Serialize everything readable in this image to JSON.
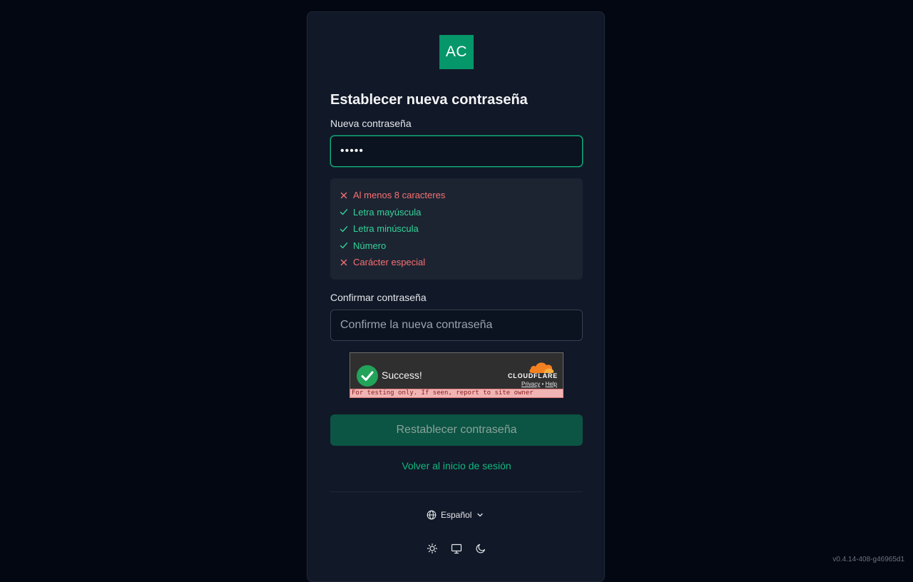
{
  "logo": {
    "text": "AC",
    "color": "#059669"
  },
  "form": {
    "title": "Establecer nueva contraseña",
    "new_password_label": "Nueva contraseña",
    "new_password_value": "•••••",
    "rules": [
      {
        "text": "Al menos 8 caracteres",
        "status": "fail"
      },
      {
        "text": "Letra mayúscula",
        "status": "ok"
      },
      {
        "text": "Letra minúscula",
        "status": "ok"
      },
      {
        "text": "Número",
        "status": "ok"
      },
      {
        "text": "Carácter especial",
        "status": "fail"
      }
    ],
    "confirm_label": "Confirmar contraseña",
    "confirm_placeholder": "Confirme la nueva contraseña",
    "submit_label": "Restablecer contraseña",
    "back_link": "Volver al inicio de sesión"
  },
  "captcha": {
    "status": "Success!",
    "brand": "CLOUDFLARE",
    "privacy": "Privacy",
    "separator": "•",
    "help": "Help",
    "banner": "For testing only. If seen, report to site owner"
  },
  "footer": {
    "language": "Español",
    "theme_icons": [
      "sun-icon",
      "monitor-icon",
      "moon-icon"
    ]
  },
  "version": "v0.4.14-408-g46965d1",
  "colors": {
    "accent": "#10b981",
    "error": "#f87171",
    "success": "#34d399",
    "background": "#030712",
    "card": "#111827"
  }
}
